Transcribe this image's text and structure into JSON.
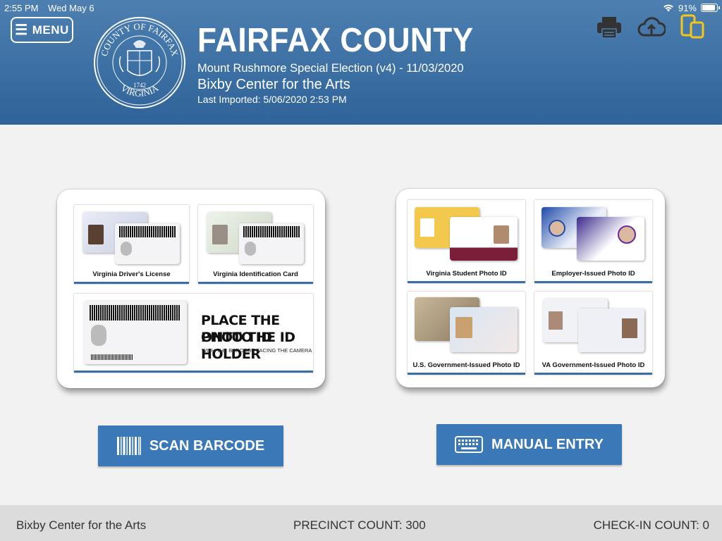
{
  "status_bar": {
    "time": "2:55 PM",
    "date": "Wed May 6",
    "battery": "91%",
    "battery_level": 0.91
  },
  "header": {
    "menu_label": "MENU",
    "seal_text_top": "COUNTY OF FAIRFAX",
    "seal_year": "1742",
    "seal_text_bottom": "VIRGINIA",
    "county": "FAIRFAX COUNTY",
    "election": "Mount Rushmore Special Election (v4) - 11/03/2020",
    "location": "Bixby Center for the Arts",
    "last_imported": "Last Imported: 5/06/2020 2:53 PM",
    "icons": [
      "printer-icon",
      "cloud-upload-icon",
      "device-switch-icon"
    ]
  },
  "left_card": {
    "tiles": [
      {
        "label": "Virginia Driver's License"
      },
      {
        "label": "Virginia Identification Card"
      }
    ],
    "instruction_line1": "PLACE THE PHOTO ID",
    "instruction_line2": "ONTO THE ID HOLDER",
    "instruction_sub": "WITH THE BARCODE FACING THE CAMERA"
  },
  "right_card": {
    "tiles": [
      {
        "label": "Virginia Student Photo ID"
      },
      {
        "label": "Employer-Issued Photo ID"
      },
      {
        "label": "U.S. Government-Issued Photo ID"
      },
      {
        "label": "VA Government-Issued Photo ID"
      }
    ]
  },
  "buttons": {
    "scan": "SCAN BARCODE",
    "manual": "MANUAL ENTRY"
  },
  "footer": {
    "location": "Bixby Center for the Arts",
    "precinct_count": "PRECINCT COUNT: 300",
    "checkin_count": "CHECK-IN COUNT: 0"
  },
  "colors": {
    "header_top": "#4d7fb0",
    "header_bottom": "#2f6399",
    "button": "#3a78b8",
    "accent_yellow": "#f5c518"
  }
}
